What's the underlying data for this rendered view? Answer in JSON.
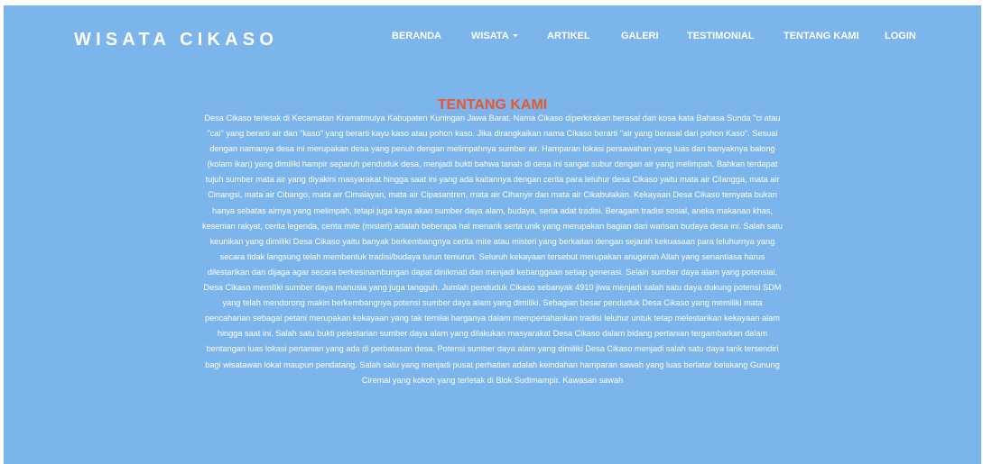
{
  "brand": {
    "title": "WISATA CIKASO"
  },
  "nav": {
    "items": [
      {
        "label": "BERANDA"
      },
      {
        "label": "WISATA",
        "dropdown": true
      },
      {
        "label": "ARTIKEL"
      },
      {
        "label": "GALERI"
      },
      {
        "label": "TESTIMONIAL"
      },
      {
        "label": "TENTANG KAMI"
      },
      {
        "label": "LOGIN"
      }
    ]
  },
  "main": {
    "title": "TENTANG KAMI",
    "body": "Desa Cikaso terletak di Kecamatan Kramatmulya Kabupaten Kuningan Jawa Barat. Nama Cikaso diperkirakan berasal dari kosa kata Bahasa Sunda \"ci atau \"cai\" yang berarti air dan \"kaso\" yang berarti kayu kaso atau pohon kaso. Jika dirangkaikan nama Cikaso berarti \"air yang berasal dari pohon Kaso\". Sesuai dengan namanya desa ini merupakan desa yang penuh dengan melimpahnya sumber air. Hamparan lokasi persawahan yang luas dan banyaknya balong (kolam ikan) yang dimiliki hampir separuh penduduk desa, menjadi bukti bahwa tanah di desa ini sangat subur dengan air yang melimpah. Bahkan terdapat tujuh sumber mata air yang diyakini masyarakat hingga saat ini yang ada kaitannya dengan cerita para leluhur desa Cikaso yaitu mata air Cilangga, mata air Cinangsi, mata air Cibango, mata air Cimalayan, mata air Cipasantren, mata air Cihanyir dan mata air Cikabulakan. Kekayaan Desa Cikaso ternyata bukan hanya sebatas airnya yang melimpah, tetapi juga kaya akan sumber daya alam, budaya, serta adat tradisi. Beragam tradisi sosial, aneka makanan khas, kesenian rakyat, cerita legenda, cerita mite (misteri) adalah beberapa hal menarik serta unik yang merupakan bagian dari warisan budaya desa ini. Salah satu keunikan yang dimiliki Desa Cikaso yaitu banyak berkembangnya cerita mite atau misteri yang berkaitan dengan sejarah kekuasaan para leluhurnya yang secara tidak langsung telah membentuk tradisi/budaya turun temurun. Seluruh kekayaan tersebut merupakan anugerah Allah yang senantiasa harus dilestarikan dan dijaga agar secara berkesinambungan dapat dinikmati dan menjadi kebanggaan setiap generasi. Selain sumber daya alam yang potensial, Desa Cikaso memiliki sumber daya manusia yang juga tangguh. Jumlah penduduk Cikaso sebanyak 4910 jiwa menjadi salah satu daya dukung potensi SDM yang telah mendorong makin berkembangnya potensi sumber daya alam yang dimiliki. Sebagian besar penduduk Desa Cikaso yang memiliki mata pencaharian sebagai petani merupakan kekayaan yang tak ternilai harganya dalam mempertahankan tradisi leluhur untuk tetap melestarikan kekayaan alam hingga saat ini. Salah satu bukti pelestarian sumber daya alam yang dilakukan masyarakat Desa Cikaso dalam bidang pertanian tergambarkan dalam bentangan luas lokasi pertanian yang ada di perbatasan desa. Potensi sumber daya alam yang dimiliki Desa Cikaso menjadi salah satu daya tarik tersendiri bagi wisatawan lokal maupun pendatang. Salah satu yang menjadi pusat perhatian adalah keindahan hamparan sawah yang luas berlatar belakang Gunung Ciremai yang kokoh yang terletak di Blok Sudimampir. Kawasan sawah"
  },
  "colors": {
    "background": "#7cb5ec",
    "text": "#ffffff",
    "title_accent": "#e8572d"
  }
}
